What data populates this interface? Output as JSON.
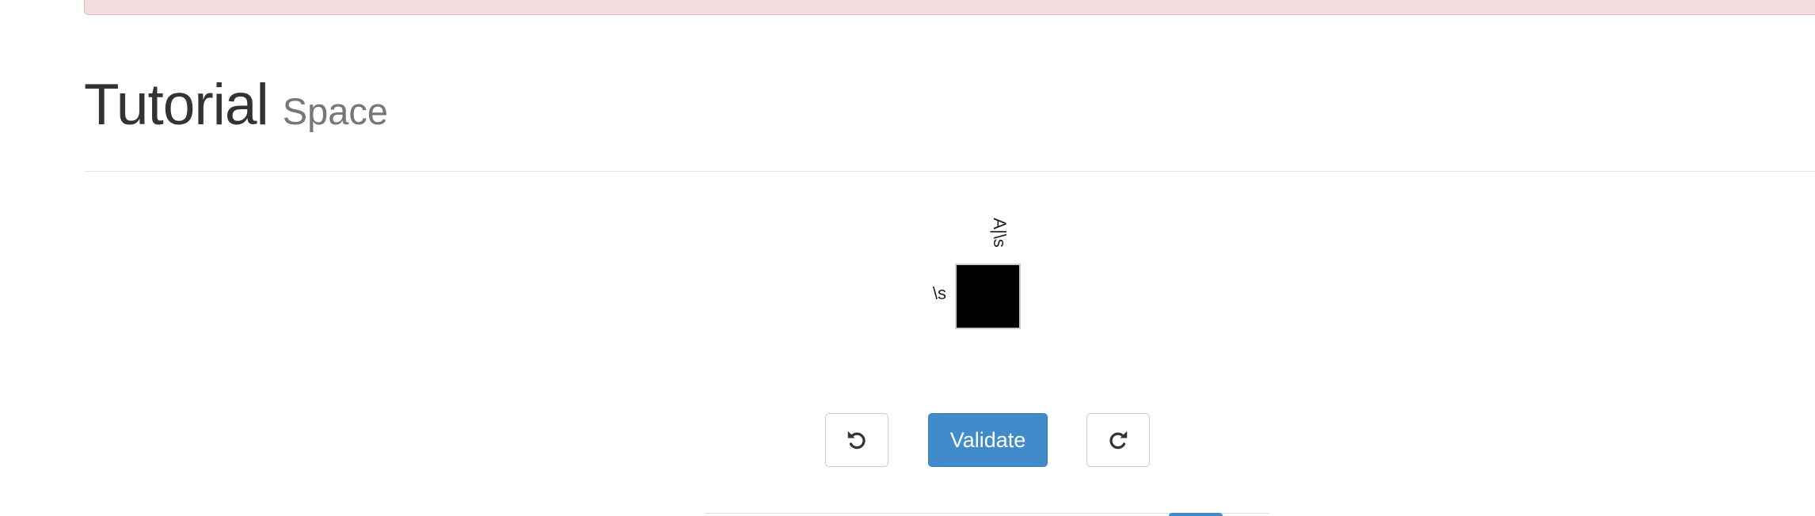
{
  "header": {
    "title": "Tutorial",
    "subtitle": "Space"
  },
  "puzzle": {
    "column_clue": "A|\\s",
    "row_clue": "\\s",
    "cell_state": "filled",
    "cell_color": "#000000"
  },
  "controls": {
    "undo_icon": "undo-icon",
    "validate_label": "Validate",
    "redo_icon": "redo-icon"
  },
  "colors": {
    "alert_background": "#f2dede",
    "primary": "#428bca",
    "subtitle": "#777777",
    "title": "#333333"
  }
}
